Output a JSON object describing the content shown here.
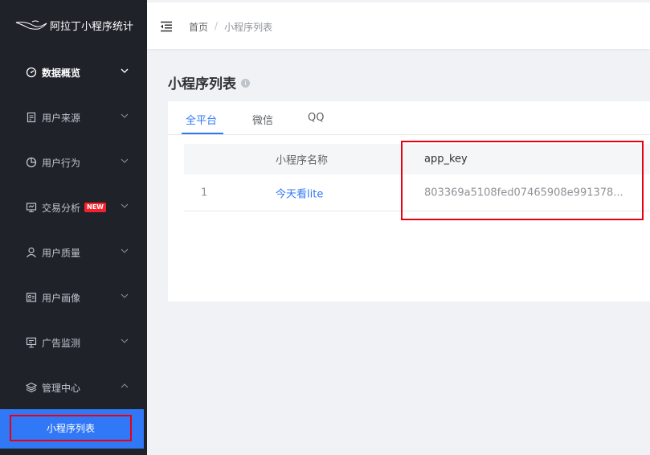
{
  "app": {
    "title": "阿拉丁小程序统计"
  },
  "sidebar": {
    "items": [
      {
        "label": "数据概览",
        "icon": "dashboard-icon"
      },
      {
        "label": "用户来源",
        "icon": "document-icon"
      },
      {
        "label": "用户行为",
        "icon": "pie-chart-icon"
      },
      {
        "label": "交易分析",
        "icon": "monitor-icon",
        "badge": "NEW"
      },
      {
        "label": "用户质量",
        "icon": "user-icon"
      },
      {
        "label": "用户画像",
        "icon": "profile-card-icon"
      },
      {
        "label": "广告监测",
        "icon": "billboard-icon"
      },
      {
        "label": "管理中心",
        "icon": "layers-icon",
        "expanded": true
      }
    ],
    "active_sub": "小程序列表"
  },
  "header": {
    "breadcrumb": [
      "首页",
      "小程序列表"
    ],
    "separator": "/"
  },
  "page": {
    "title": "小程序列表"
  },
  "tabs": [
    "全平台",
    "微信",
    "QQ"
  ],
  "active_tab": 0,
  "table": {
    "columns": [
      "",
      "小程序名称",
      "app_key"
    ],
    "rows": [
      {
        "index": "1",
        "name": "今天看lite",
        "app_key": "803369a5108fed07465908e991378..."
      }
    ]
  },
  "colors": {
    "accent": "#3178f6",
    "sidebar_bg": "#1f2229",
    "highlight": "#e60012",
    "badge": "#f5222d"
  }
}
